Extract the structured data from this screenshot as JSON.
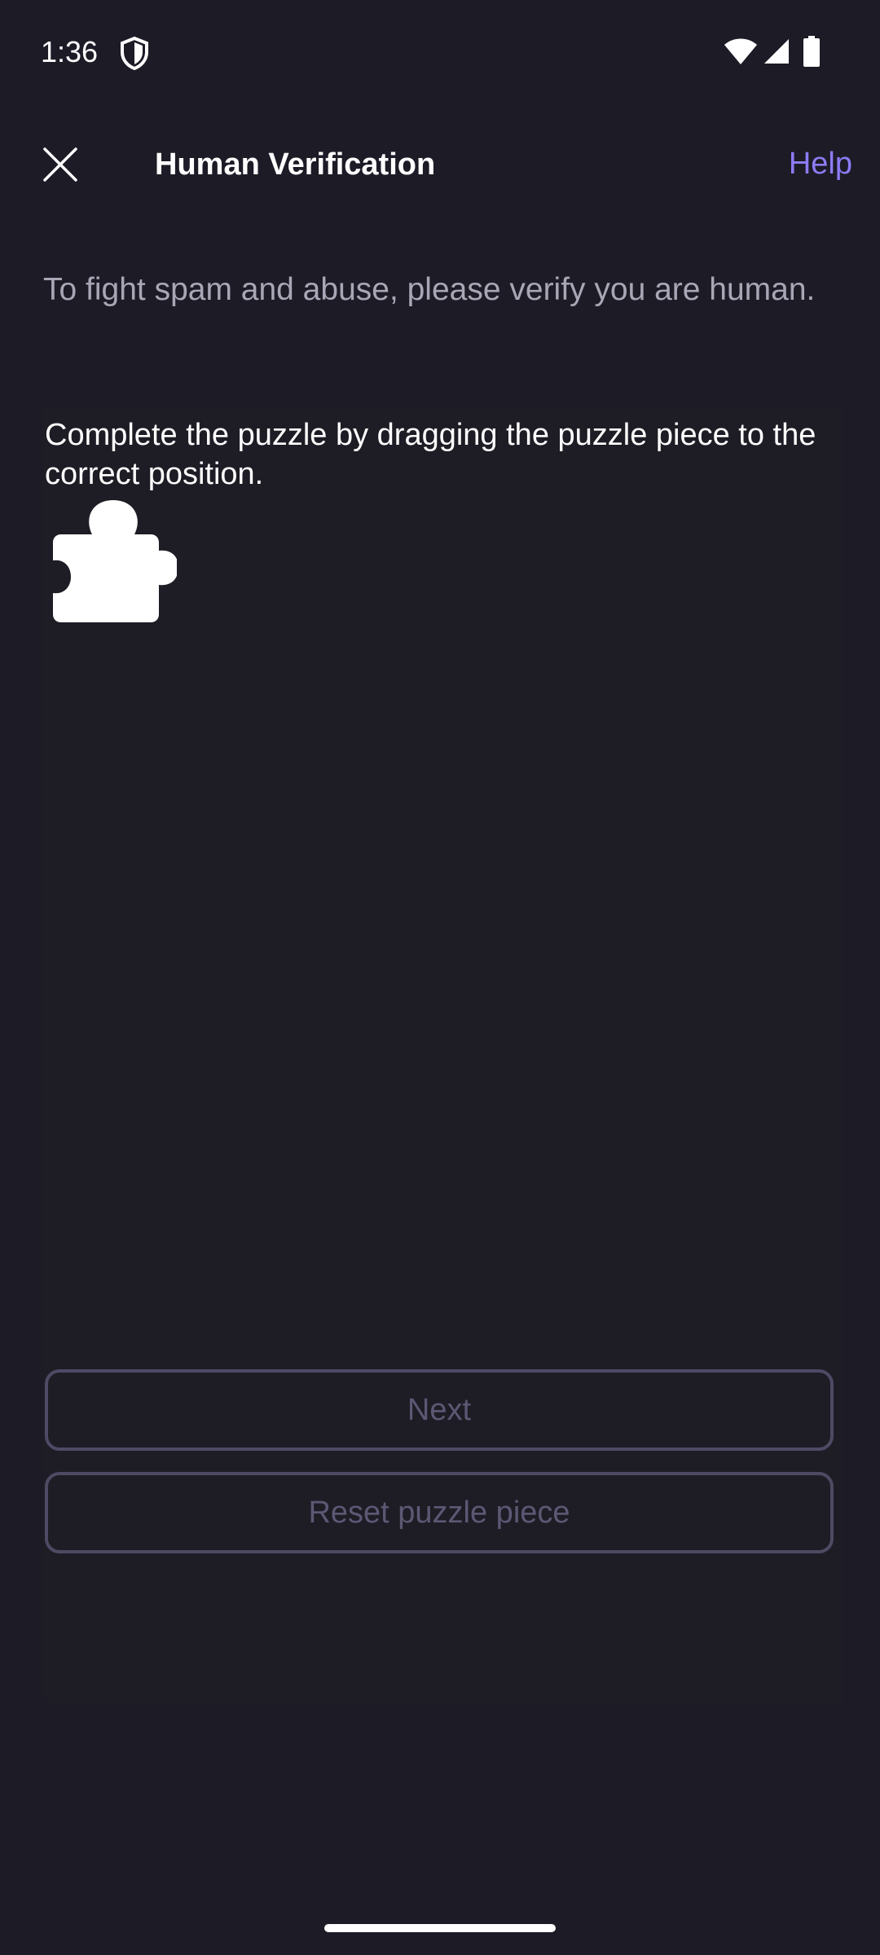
{
  "status_bar": {
    "time": "1:36",
    "icons": [
      "shield-icon",
      "wifi-icon",
      "signal-icon",
      "battery-icon"
    ]
  },
  "app_bar": {
    "title": "Human Verification",
    "help_label": "Help",
    "close_icon": "close-icon"
  },
  "intro": {
    "text": "To fight spam and abuse, please verify you are human."
  },
  "captcha": {
    "instruction": "Complete the puzzle by dragging the puzzle piece to the correct position.",
    "piece_icon": "puzzle-piece-icon"
  },
  "buttons": {
    "next_label": "Next",
    "reset_label": "Reset puzzle piece"
  },
  "colors": {
    "background": "#1d1b26",
    "accent": "#8c7cf5",
    "muted_text": "#a9a7b5",
    "disabled_border": "#4e4a64",
    "disabled_text": "#5c5874"
  }
}
